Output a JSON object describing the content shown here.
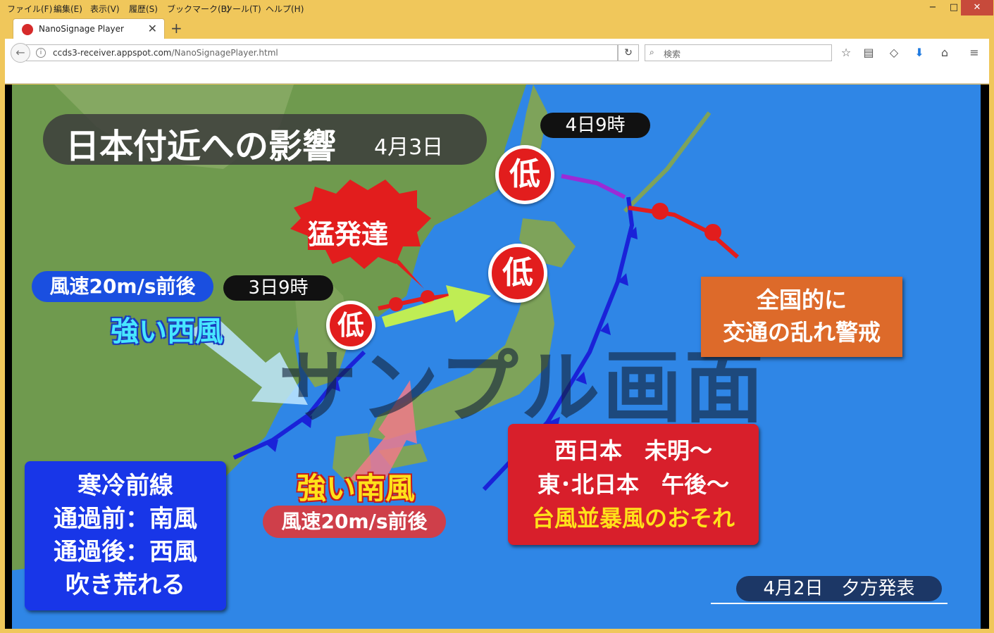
{
  "browser": {
    "menu": [
      "ファイル(F)",
      "編集(E)",
      "表示(V)",
      "履歴(S)",
      "ブックマーク(B)",
      "ツール(T)",
      "ヘルプ(H)"
    ],
    "window_controls": {
      "minimize": "−",
      "maximize": "□",
      "close": "✕"
    },
    "tab": {
      "title": "NanoSignage Player",
      "close": "✕"
    },
    "new_tab": "+",
    "url_host": "ccds3-receiver.appspot.com",
    "url_path": "/NanoSignagePlayer.html",
    "search_placeholder": "検索",
    "icons": [
      "back-icon",
      "info-icon",
      "reload-icon",
      "search-icon",
      "star-icon",
      "reading-list-icon",
      "pocket-icon",
      "download-icon",
      "home-icon",
      "menu-icon"
    ],
    "accent_color": "#f0c75b"
  },
  "map": {
    "title": "日本付近への影響",
    "title_date": "4月3日",
    "time_label_1": "4日9時",
    "time_label_2": "3日9時",
    "low_label": "低",
    "burst_text": "猛発達",
    "wind_west_speed": "風速20m/s前後",
    "wind_west_label": "強い西風",
    "wind_south_label": "強い南風",
    "wind_south_speed": "風速20m/s前後",
    "watermark": "サンプル画面",
    "orange_box": [
      "全国的に",
      "交通の乱れ警戒"
    ],
    "red_box": [
      "西日本　未明～",
      "東･北日本　午後～",
      "台風並暴風のおそれ"
    ],
    "blue_box": [
      "寒冷前線",
      "通過前：南風",
      "通過後：西風",
      "吹き荒れる"
    ],
    "issued": "4月2日　夕方発表",
    "colors": {
      "sea": "#2f86e6",
      "cold_front": "#1a22d8",
      "warm_front": "#e21d1d",
      "occluded_front": "#9b2bd6",
      "low": "#e21d1d"
    }
  }
}
